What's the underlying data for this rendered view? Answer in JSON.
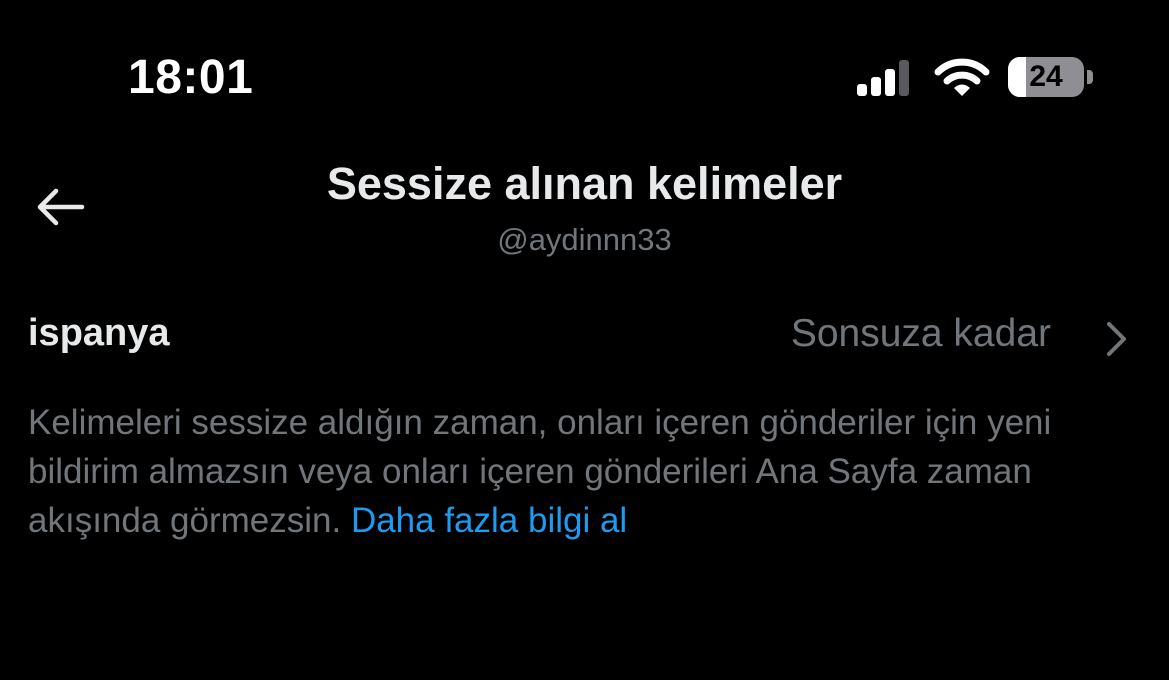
{
  "status_bar": {
    "time": "18:01",
    "battery_label": "24",
    "battery_level": 0.24,
    "icons": [
      "signal-icon",
      "wifi-icon",
      "battery-icon"
    ]
  },
  "header": {
    "title": "Sessize alınan kelimeler",
    "subtitle": "@aydinnn33",
    "back_icon": "arrow-left-icon"
  },
  "muted_words": [
    {
      "word": "ispanya",
      "duration": "Sonsuza kadar",
      "icon": "chevron-right-icon"
    }
  ],
  "info": {
    "text": "Kelimeleri sessize aldığın zaman, onları içeren gönderiler için yeni bildirim almazsın veya onları içeren gönderileri Ana Sayfa zaman akışında görmezsin. ",
    "link_label": "Daha fazla bilgi al"
  },
  "colors": {
    "background": "#000000",
    "primary_text": "#e7e9ea",
    "secondary_text": "#71767b",
    "link": "#1d9bf0"
  }
}
